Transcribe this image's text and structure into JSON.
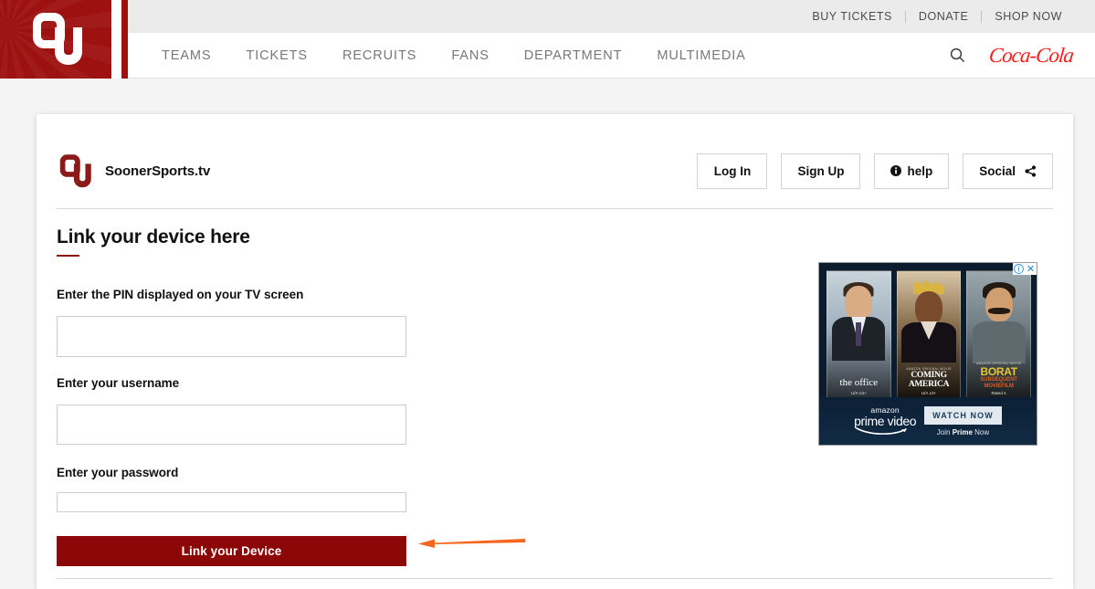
{
  "site_header": {
    "logo_alt": "University of Oklahoma OU logo",
    "utility_links": [
      {
        "label": "BUY TICKETS"
      },
      {
        "label": "DONATE"
      },
      {
        "label": "SHOP NOW"
      }
    ],
    "nav_items": [
      {
        "label": "TEAMS"
      },
      {
        "label": "TICKETS"
      },
      {
        "label": "RECRUITS"
      },
      {
        "label": "FANS"
      },
      {
        "label": "DEPARTMENT"
      },
      {
        "label": "MULTIMEDIA"
      }
    ],
    "search_icon": "search-icon",
    "sponsor_logo": "Coca-Cola"
  },
  "card": {
    "brand_name": "SoonerSports.tv",
    "brand_logo": "ou-logo-icon",
    "buttons": [
      {
        "label": "Log In",
        "icon": ""
      },
      {
        "label": "Sign Up",
        "icon": ""
      },
      {
        "label": "help",
        "icon": "info-circle-icon"
      },
      {
        "label": "Social",
        "icon": "share-icon"
      }
    ]
  },
  "form": {
    "title": "Link your device here",
    "pin": {
      "label": "Enter the PIN displayed on your TV screen",
      "value": "",
      "placeholder": ""
    },
    "username": {
      "label": "Enter your username",
      "value": "",
      "placeholder": ""
    },
    "password": {
      "label": "Enter your password",
      "value": "",
      "placeholder": ""
    },
    "submit_label": "Link your Device"
  },
  "annotation": {
    "type": "arrow",
    "color": "#f4671c",
    "points_to": "link-your-device-button"
  },
  "ad": {
    "info_badge": "i",
    "close_badge": "✕",
    "posters": [
      {
        "title": "the office",
        "original_tag": "",
        "rating": "U/A 13+"
      },
      {
        "title_line1": "COMING",
        "title_line2": "AMERICA",
        "original_tag": "AMAZON ORIGINAL MOVIE",
        "rating": "U/A 13+"
      },
      {
        "title": "BORAT",
        "subtitle_line1": "SUBSEQUENT",
        "subtitle_line2": "MOVIEFILM",
        "original_tag": "AMAZON ORIGINAL MOVIE",
        "rating": "Rated A"
      }
    ],
    "footer": {
      "amazon": "amazon",
      "service": "prime video",
      "cta": "WATCH NOW",
      "join_prefix": "Join ",
      "join_bold": "Prime",
      "join_suffix": " Now"
    }
  },
  "colors": {
    "crimson": "#9d1111",
    "button_red": "#8c0707",
    "utility_bar": "#ebebeb",
    "arrow_orange": "#f4671c",
    "coke_red": "#ee2222"
  }
}
